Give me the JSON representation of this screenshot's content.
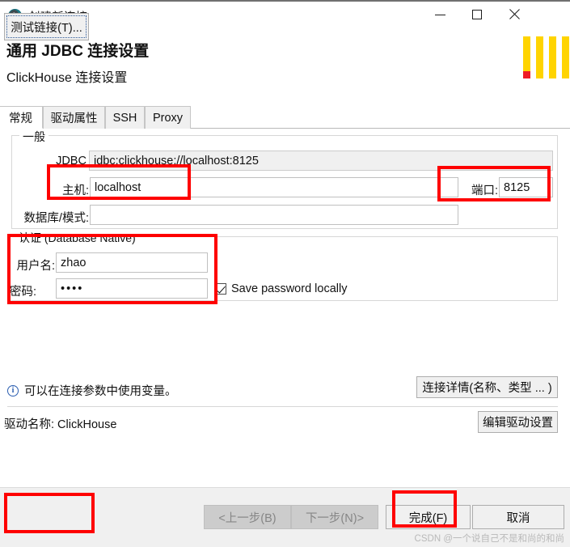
{
  "window": {
    "title": "创建新连接",
    "icon": "dbeaver-beaver-icon",
    "minimize_label": "—",
    "maximize_label": "□",
    "close_label": "✕"
  },
  "header": {
    "title": "通用 JDBC 连接设置",
    "subtitle": "ClickHouse 连接设置",
    "logo": "dbeaver-logo"
  },
  "tabs": [
    {
      "label": "常规",
      "active": true
    },
    {
      "label": "驱动属性",
      "active": false
    },
    {
      "label": "SSH",
      "active": false
    },
    {
      "label": "Proxy",
      "active": false
    }
  ],
  "general_group": {
    "legend": "一般",
    "jdbc_url": {
      "label": "JDBC URL:",
      "value": "jdbc:clickhouse://localhost:8125",
      "readonly": true
    },
    "host": {
      "label": "主机:",
      "value": "localhost"
    },
    "port": {
      "label": "端口:",
      "value": "8125"
    },
    "database": {
      "label": "数据库/模式:",
      "value": ""
    }
  },
  "auth_group": {
    "legend": "认证 (Database Native)",
    "username": {
      "label": "用户名:",
      "value": "zhao"
    },
    "password": {
      "label": "密码:",
      "value": "••••"
    },
    "save_password": {
      "label": "Save password locally",
      "checked": true
    }
  },
  "info": {
    "icon": "info-circle-icon",
    "text": "可以在连接参数中使用变量。"
  },
  "buttons": {
    "connection_details": "连接详情(名称、类型 ... )",
    "edit_driver": "编辑驱动设置",
    "test_connection": "测试链接(T)...",
    "previous": "<上一步(B)",
    "next": "下一步(N)>",
    "finish": "完成(F)",
    "cancel": "取消"
  },
  "driver": {
    "label": "驱动名称: ClickHouse"
  },
  "watermark": "CSDN @一个说自己不是和尚的和尚",
  "colors": {
    "annotation_red": "#fe0000",
    "logo_yellow": "#ffd400",
    "logo_red": "#ee1c25",
    "info_blue": "#2a5db0"
  }
}
